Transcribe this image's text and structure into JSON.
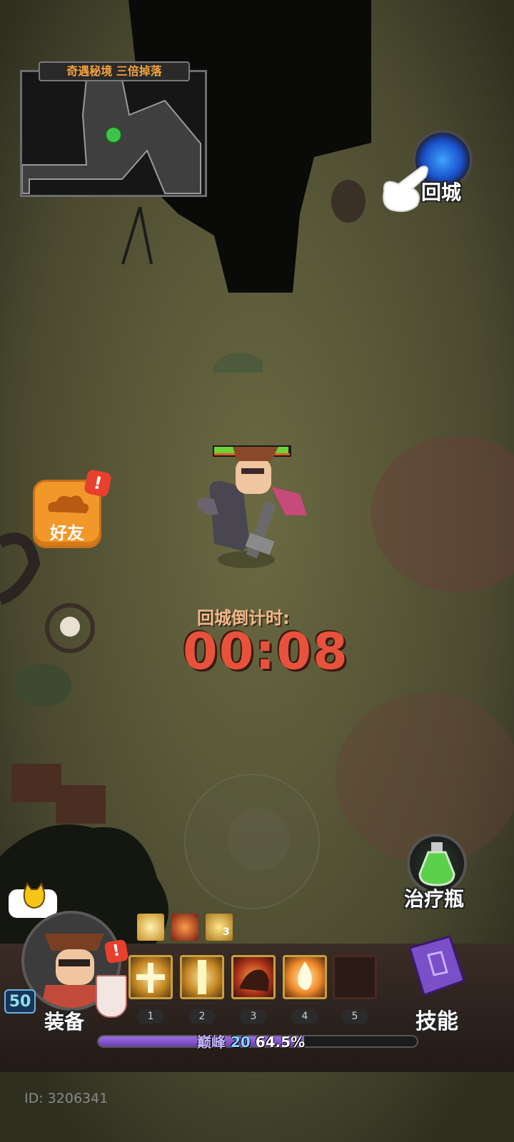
{
  "minimap": {
    "title": "奇遇秘境 三倍掉落"
  },
  "return_button": {
    "label": "回城"
  },
  "friend_button": {
    "label": "好友",
    "badge": "!"
  },
  "countdown": {
    "label": "回城倒计时:",
    "value": "00:08"
  },
  "potion_button": {
    "label": "治疗瓶"
  },
  "equip_button": {
    "label": "装备",
    "badge": "!"
  },
  "skills_button": {
    "label": "技能"
  },
  "player": {
    "level": "50",
    "id_text": "ID: 3206341",
    "hp_fraction": 0.98
  },
  "buffs": [
    {
      "icon": "light-buff-icon"
    },
    {
      "icon": "fire-buff-icon"
    },
    {
      "icon": "lightning-buff-icon",
      "count": "3"
    }
  ],
  "skill_slots": [
    {
      "num": "1",
      "icon": "holy-cross-skill-icon"
    },
    {
      "num": "2",
      "icon": "light-beam-skill-icon"
    },
    {
      "num": "3",
      "icon": "fire-beast-skill-icon"
    },
    {
      "num": "4",
      "icon": "flame-burst-skill-icon"
    },
    {
      "num": "5",
      "icon": ""
    }
  ],
  "experience": {
    "tier": "巅峰",
    "tier_level": "20",
    "percent_text": "64.5%",
    "fraction": 0.645
  },
  "colors": {
    "accent_orange": "#f2982a",
    "countdown_red": "#e8523c",
    "xp_purple": "#7f4fd0",
    "hp_green": "#6fd23a"
  }
}
